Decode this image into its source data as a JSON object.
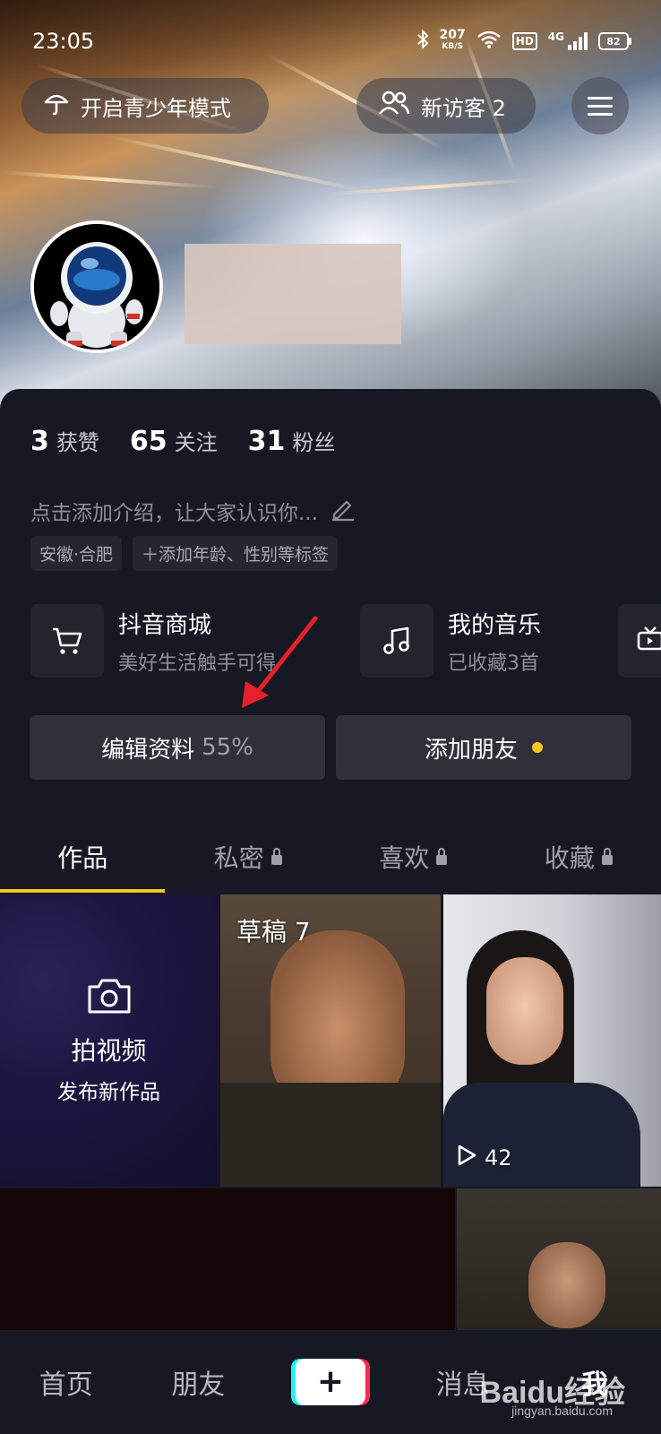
{
  "status_bar": {
    "time": "23:05",
    "net_speed": "207",
    "net_unit": "KB/S",
    "hd_label": "HD",
    "net_type": "4G",
    "battery": "82"
  },
  "header": {
    "youth_mode_label": "开启青少年模式",
    "visitor_label": "新访客 2"
  },
  "profile": {
    "stats": [
      {
        "value": "3",
        "label": "获赞"
      },
      {
        "value": "65",
        "label": "关注"
      },
      {
        "value": "31",
        "label": "粉丝"
      }
    ],
    "bio_placeholder": "点击添加介绍，让大家认识你...",
    "tags": [
      "安徽·合肥",
      "＋添加年龄、性别等标签"
    ]
  },
  "shortcuts": [
    {
      "title": "抖音商城",
      "subtitle": "美好生活触手可得"
    },
    {
      "title": "我的音乐",
      "subtitle": "已收藏3首"
    }
  ],
  "actions": {
    "edit_label": "编辑资料",
    "edit_progress": "55%",
    "add_friend_label": "添加朋友"
  },
  "tabs": [
    {
      "label": "作品",
      "locked": false
    },
    {
      "label": "私密",
      "locked": true
    },
    {
      "label": "喜欢",
      "locked": true
    },
    {
      "label": "收藏",
      "locked": true
    }
  ],
  "grid": {
    "shoot_title": "拍视频",
    "shoot_subtitle": "发布新作品",
    "draft_label": "草稿 7",
    "video_views": "42"
  },
  "bottom_nav": {
    "home": "首页",
    "friends": "朋友",
    "plus": "+",
    "messages": "消息",
    "me": "我"
  },
  "watermark": {
    "brand": "Baidu经验",
    "url": "jingyan.baidu.com"
  },
  "colors": {
    "background": "#161823",
    "accent_yellow": "#f6c81c",
    "arrow_red": "#e8202a"
  }
}
